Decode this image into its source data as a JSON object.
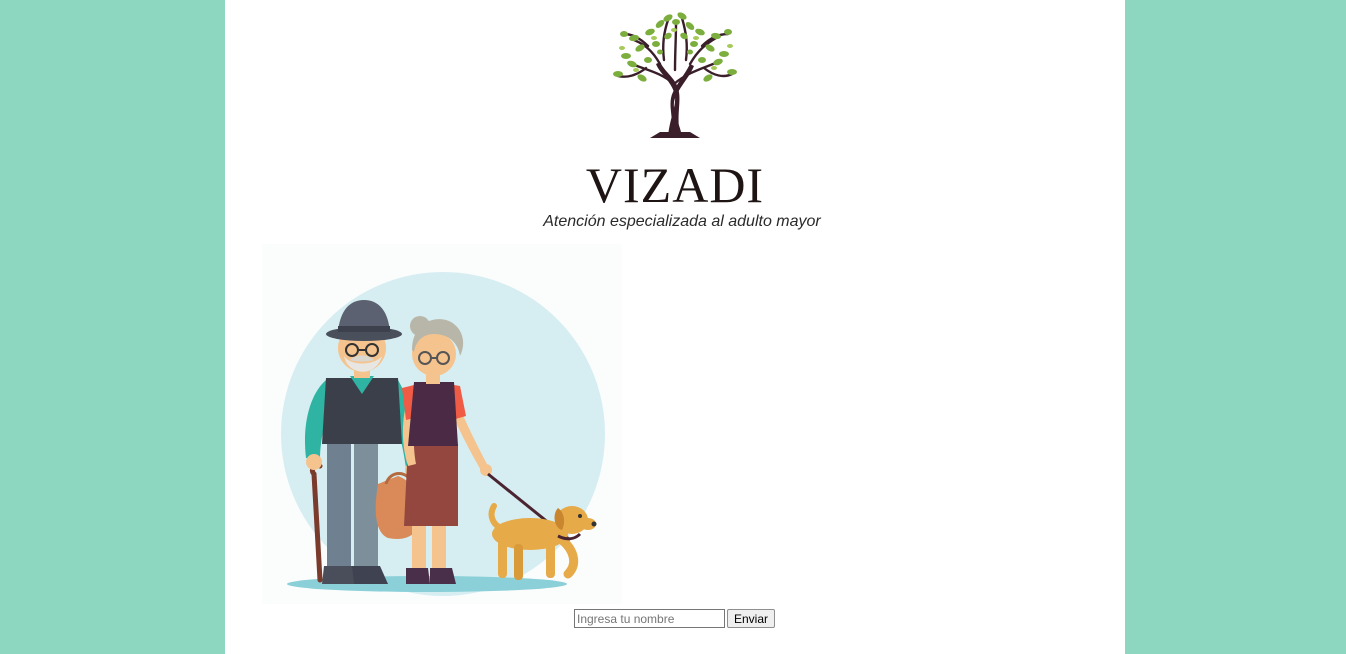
{
  "header": {
    "brand_name": "VIZADI",
    "tagline": "Atención especializada al adulto mayor",
    "logo_icon": "tree-icon"
  },
  "hero": {
    "illustration": "elderly-couple-walking-dog"
  },
  "form": {
    "name_placeholder": "Ingresa tu nombre",
    "name_value": "",
    "submit_label": "Enviar"
  },
  "colors": {
    "side_background": "#8dd6bf",
    "content_background": "#ffffff",
    "leaf_green": "#7cae3e",
    "trunk_brown": "#3a1f2a"
  }
}
